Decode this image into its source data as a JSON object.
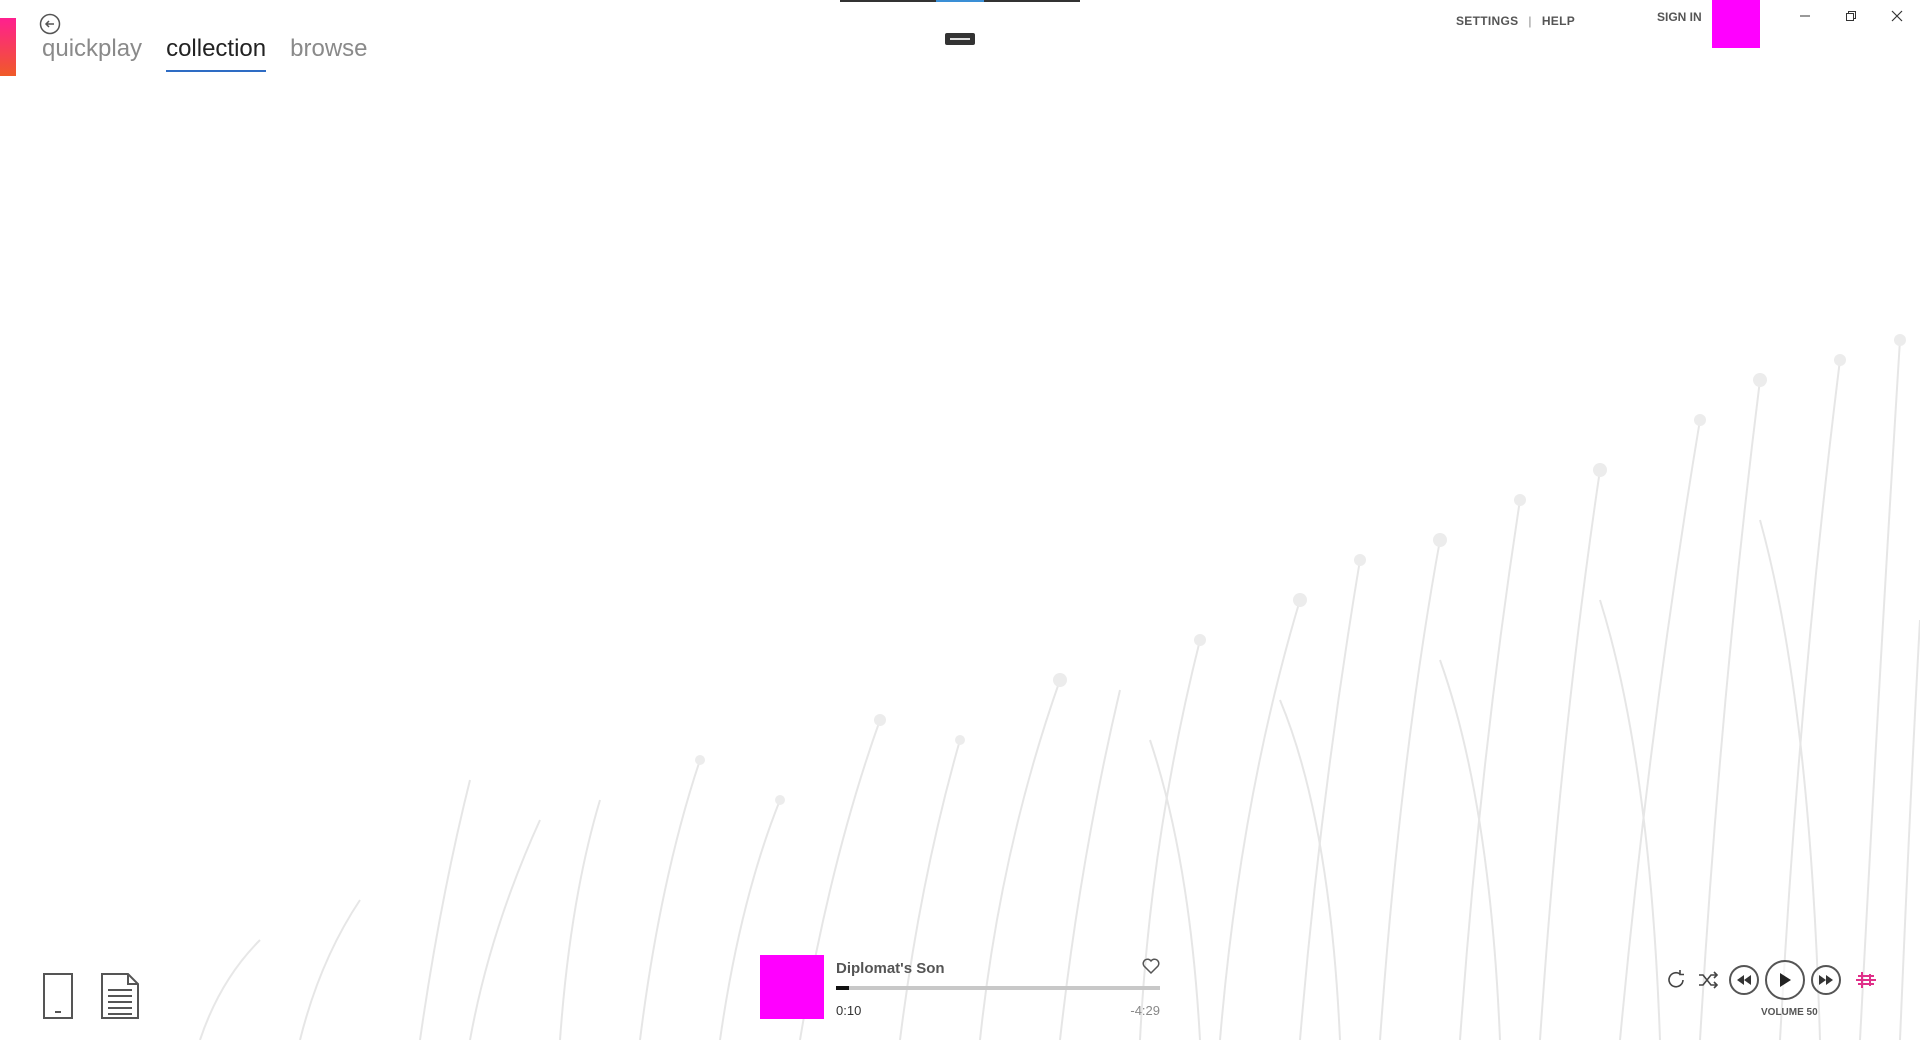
{
  "nav": {
    "tabs": [
      {
        "label": "quickplay",
        "active": false
      },
      {
        "label": "collection",
        "active": true
      },
      {
        "label": "browse",
        "active": false
      }
    ]
  },
  "header": {
    "settings_label": "SETTINGS",
    "separator": "|",
    "help_label": "HELP",
    "sign_in_label": "SIGN IN"
  },
  "player": {
    "track_title": "Diplomat's Son",
    "elapsed": "0:10",
    "remaining": "-4:29",
    "progress": 0.04,
    "volume_label": "VOLUME 50"
  },
  "colors": {
    "accent_gradient_top": "#ff1f8f",
    "accent_gradient_bottom": "#f05a28",
    "album_placeholder": "#ff00ff",
    "avatar_placeholder": "#ff00ff",
    "active_tab_underline": "#2e6cc4",
    "equalizer_icon": "#e0308a"
  },
  "icons": {
    "back": "back-arrow-circle-icon",
    "device": "phone-device-icon",
    "now_playing_list": "document-list-icon",
    "favorite": "heart-icon",
    "repeat": "repeat-icon",
    "shuffle": "shuffle-icon",
    "previous": "rewind-icon",
    "play": "play-icon",
    "next": "fast-forward-icon",
    "equalizer": "equalizer-icon"
  }
}
